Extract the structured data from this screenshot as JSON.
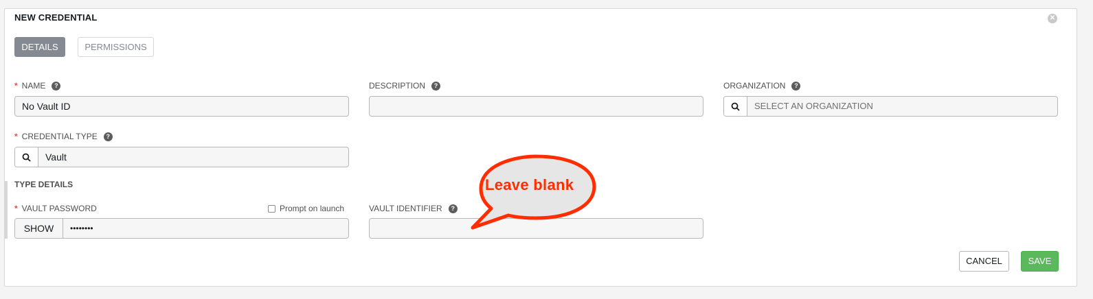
{
  "form": {
    "title": "NEW CREDENTIAL",
    "tabs": [
      {
        "label": "DETAILS"
      },
      {
        "label": "PERMISSIONS"
      }
    ],
    "fields": {
      "name": {
        "label": "NAME",
        "required_mark": "*",
        "value": "No Vault ID"
      },
      "description": {
        "label": "DESCRIPTION",
        "value": ""
      },
      "organization": {
        "label": "ORGANIZATION",
        "placeholder": "SELECT AN ORGANIZATION"
      },
      "credential_type": {
        "label": "CREDENTIAL TYPE",
        "required_mark": "*",
        "value": "Vault"
      }
    },
    "type_details": {
      "title": "TYPE DETAILS",
      "vault_password": {
        "label": "VAULT PASSWORD",
        "required_mark": "*",
        "show_label": "SHOW",
        "value": "••••••••",
        "prompt_label": "Prompt on launch",
        "prompt_checked": false
      },
      "vault_identifier": {
        "label": "VAULT IDENTIFIER",
        "value": ""
      }
    },
    "actions": {
      "cancel": "CANCEL",
      "save": "SAVE"
    }
  },
  "annotation": {
    "text": "Leave blank"
  },
  "icons": {
    "help": "question-circle-icon",
    "search": "search-icon",
    "close": "close-circle-icon"
  },
  "colors": {
    "required": "#d9534f",
    "save": "#5cb85c",
    "tab_active": "#848992",
    "annotation": "#ff2d00"
  }
}
